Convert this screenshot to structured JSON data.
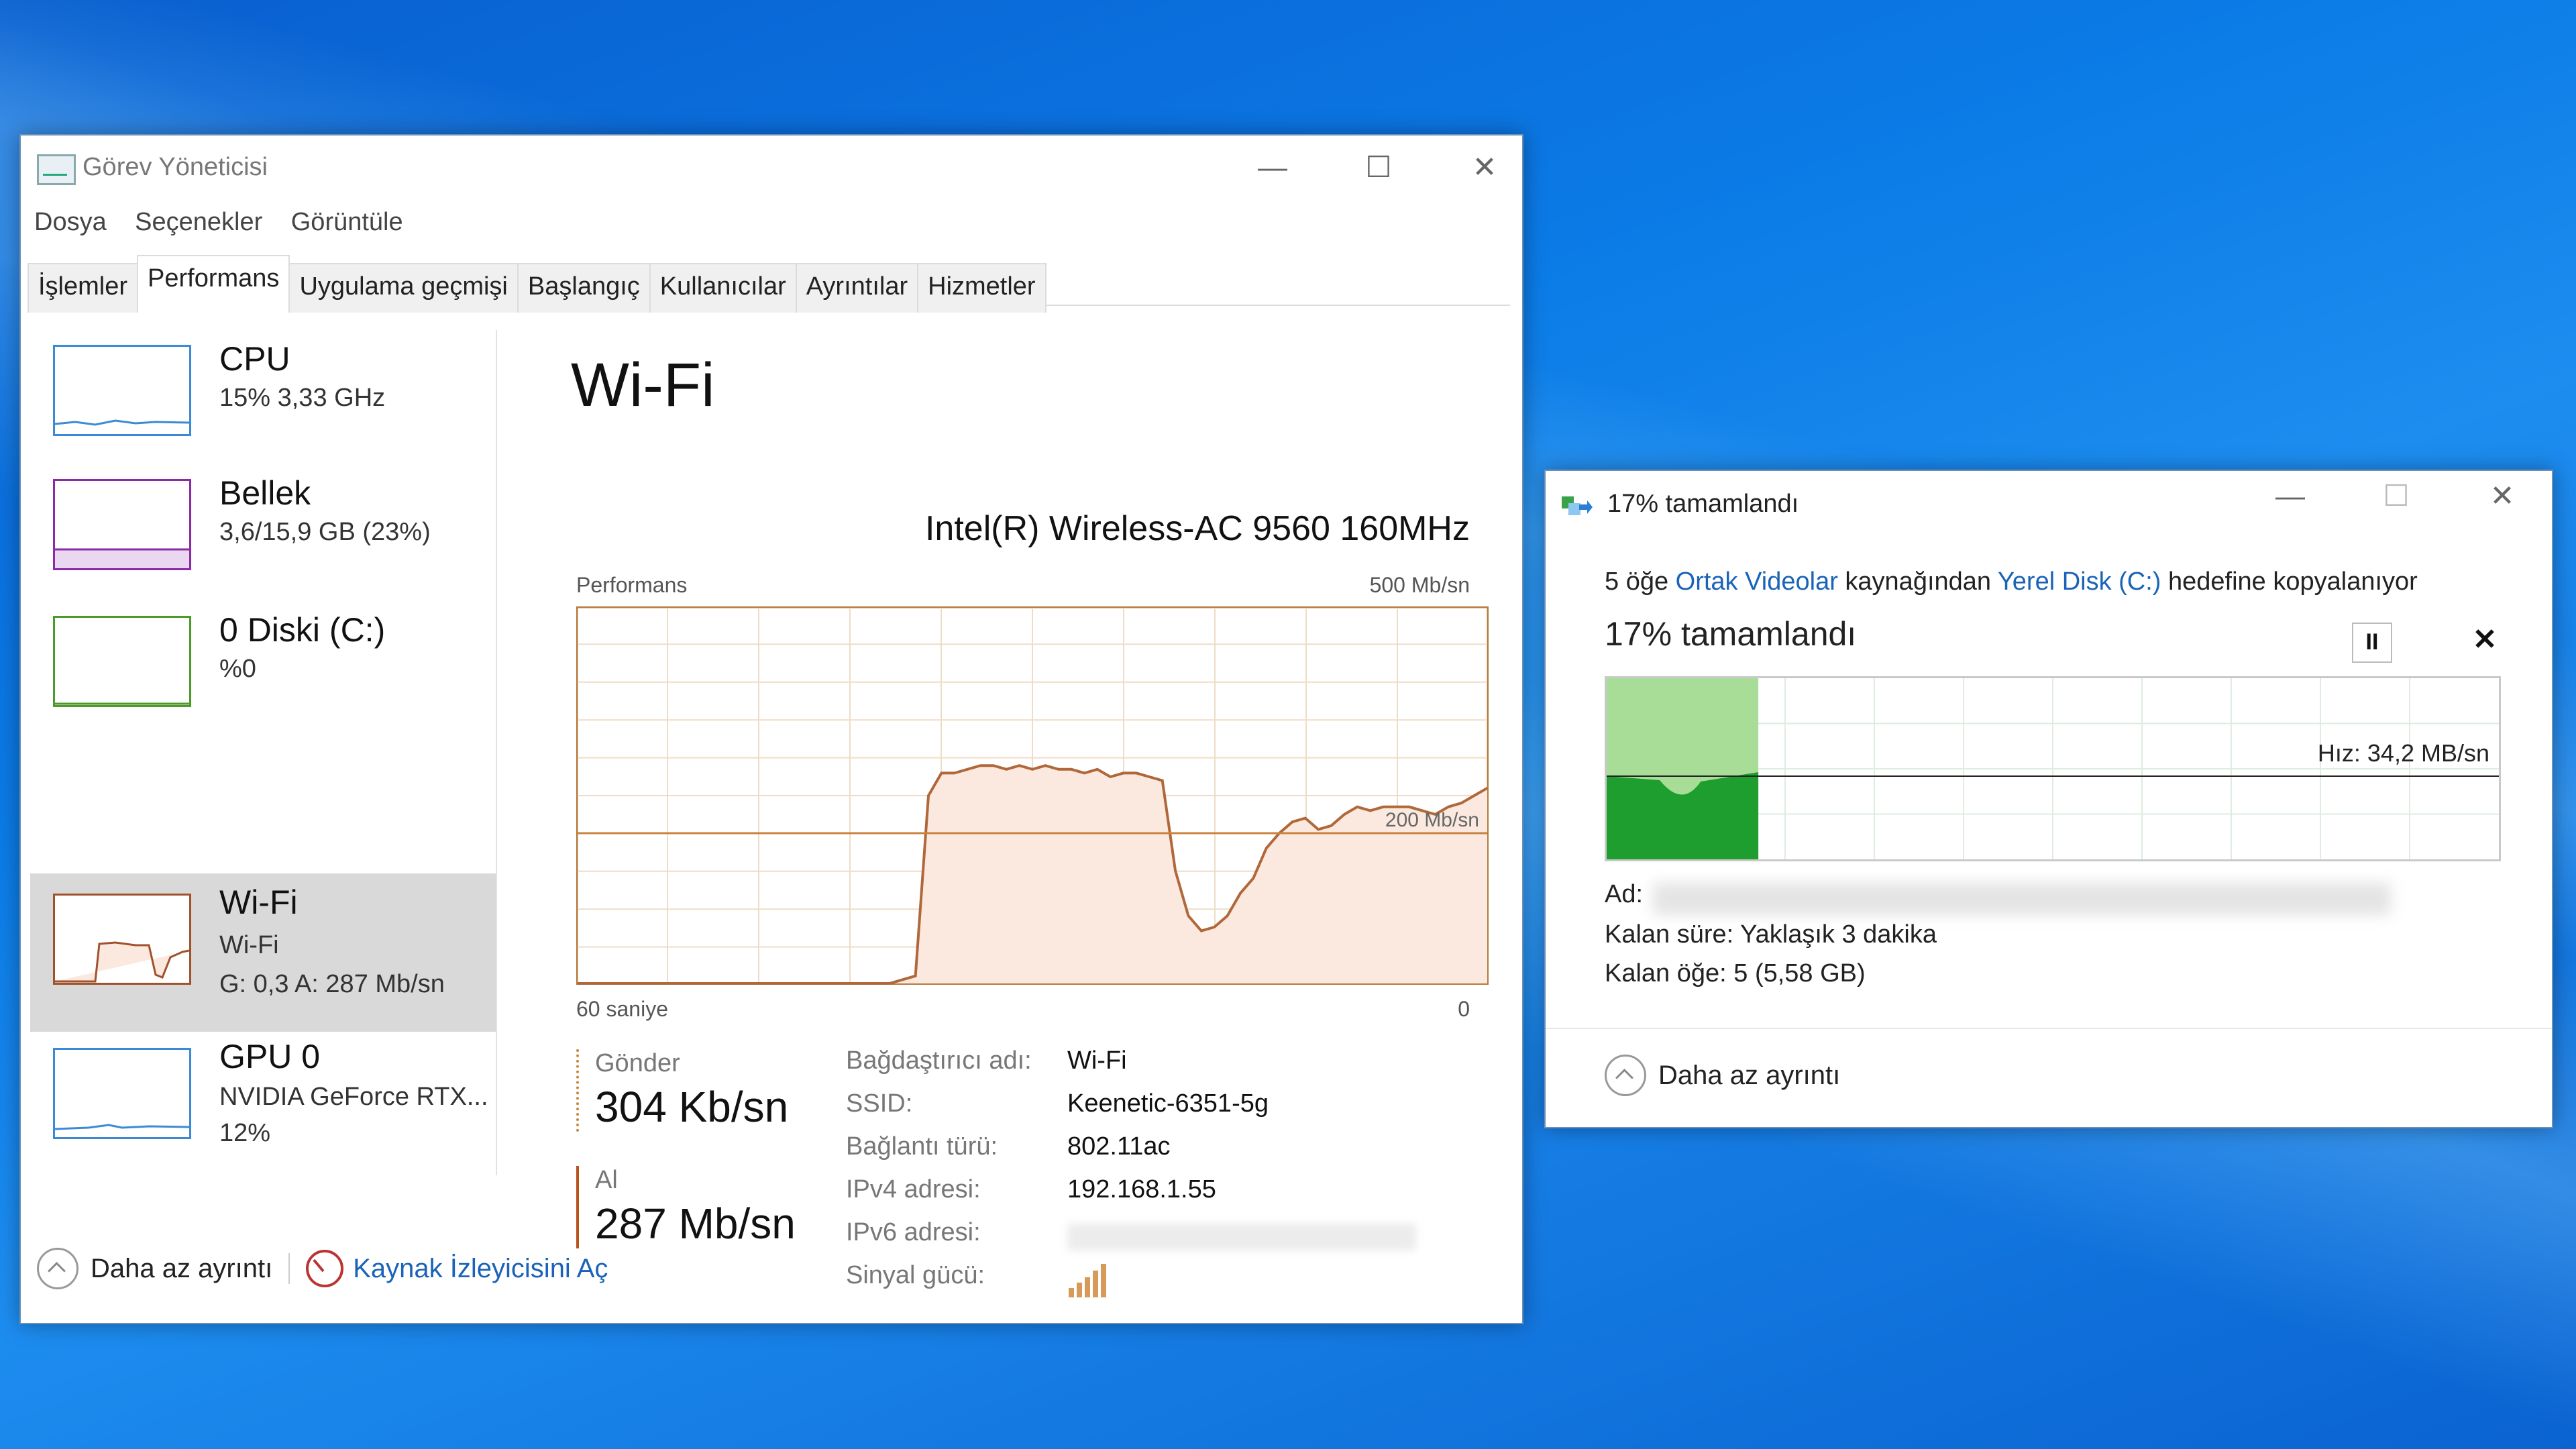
{
  "task_manager": {
    "title": "Görev Yöneticisi",
    "menu": [
      "Dosya",
      "Seçenekler",
      "Görüntüle"
    ],
    "tabs": [
      "İşlemler",
      "Performans",
      "Uygulama geçmişi",
      "Başlangıç",
      "Kullanıcılar",
      "Ayrıntılar",
      "Hizmetler"
    ],
    "active_tab": "Performans",
    "sidebar": [
      {
        "name": "CPU",
        "line1": "15%  3,33 GHz",
        "line2": "",
        "color": "#3c8ad6"
      },
      {
        "name": "Bellek",
        "line1": "3,6/15,9 GB (23%)",
        "line2": "",
        "color": "#8b2aa6"
      },
      {
        "name": "0 Diski (C:)",
        "line1": "%0",
        "line2": "",
        "color": "#4c9a2a"
      },
      {
        "name": "Wi-Fi",
        "line1": "Wi-Fi",
        "line2": "G: 0,3  A: 287 Mb/sn",
        "color": "#a0522d"
      },
      {
        "name": "GPU 0",
        "line1": "NVIDIA GeForce RTX...",
        "line2": "12%",
        "color": "#3c8ad6"
      }
    ],
    "main": {
      "title": "Wi-Fi",
      "adapter": "Intel(R) Wireless-AC 9560 160MHz",
      "graph_label": "Performans",
      "graph_max": "500 Mb/sn",
      "graph_line_label": "200 Mb/sn",
      "time_label": "60 saniye",
      "zero_label": "0"
    },
    "send": {
      "label": "Gönder",
      "value": "304 Kb/sn"
    },
    "receive": {
      "label": "Al",
      "value": "287 Mb/sn"
    },
    "info": [
      {
        "key": "Bağdaştırıcı adı:",
        "value": "Wi-Fi"
      },
      {
        "key": "SSID:",
        "value": "Keenetic-6351-5g"
      },
      {
        "key": "Bağlantı türü:",
        "value": "802.11ac"
      },
      {
        "key": "IPv4 adresi:",
        "value": "192.168.1.55"
      },
      {
        "key": "IPv6 adresi:",
        "value": ""
      },
      {
        "key": "Sinyal gücü:",
        "value": ""
      }
    ],
    "footer": {
      "less_details": "Daha az ayrıntı",
      "resmon": "Kaynak İzleyicisini Aç"
    }
  },
  "copy_dialog": {
    "title": "17%  tamamlandı",
    "desc_prefix": "5 öğe ",
    "source": "Ortak Videolar",
    "desc_middle": " kaynağından ",
    "dest": "Yerel Disk (C:)",
    "desc_suffix": " hedefine kopyalanıyor",
    "status": "17%  tamamlandı",
    "pause_glyph": "II",
    "close_glyph": "✕",
    "speed_label": "Hız: 34,2 MB/sn",
    "progress_percent": 17,
    "name_label": "Ad:",
    "remaining_time": "Kalan süre:  Yaklaşık 3 dakika",
    "remaining_items": "Kalan öğe:  5 (5,58 GB)",
    "less_details": "Daha az ayrıntı"
  },
  "wifi_graph_series": [
    0,
    0,
    0,
    0,
    0,
    0,
    0,
    0,
    0,
    0,
    0,
    0,
    0,
    0,
    0,
    0,
    0,
    0,
    0,
    0,
    0,
    0,
    0,
    0,
    0,
    1,
    2,
    50,
    56,
    56,
    57,
    58,
    58,
    57,
    58,
    57,
    58,
    57,
    57,
    56,
    57,
    55,
    56,
    56,
    55,
    54,
    30,
    18,
    14,
    15,
    18,
    24,
    28,
    36,
    40,
    43,
    44,
    41,
    42,
    45,
    47,
    46,
    47,
    47,
    47,
    46,
    45,
    47,
    48,
    50,
    52
  ]
}
